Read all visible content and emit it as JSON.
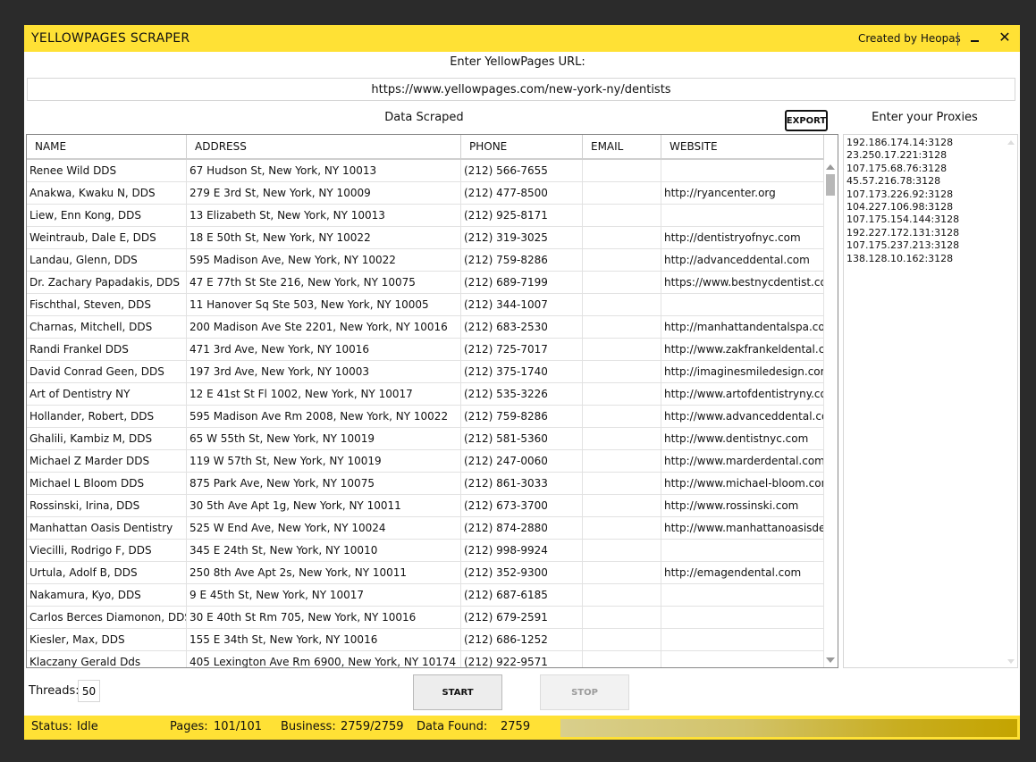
{
  "app": {
    "title": "YELLOWPAGES SCRAPER",
    "created_by": "Created by Heopas",
    "minimize_icon": "minimize-icon",
    "close_icon": "close-icon",
    "close_glyph": "✕"
  },
  "url_section": {
    "label": "Enter YellowPages URL:",
    "value": "https://www.yellowpages.com/new-york-ny/dentists"
  },
  "data_section": {
    "label": "Data Scraped",
    "export_label": "EXPORT"
  },
  "table": {
    "columns": [
      "NAME",
      "ADDRESS",
      "PHONE",
      "EMAIL",
      "WEBSITE"
    ],
    "rows": [
      [
        "Renee Wild DDS",
        "67 Hudson St, New York, NY 10013",
        "(212) 566-7655",
        "",
        ""
      ],
      [
        "Anakwa, Kwaku N, DDS",
        "279 E 3rd St, New York, NY 10009",
        "(212) 477-8500",
        "",
        "http://ryancenter.org"
      ],
      [
        "Liew, Enn Kong, DDS",
        "13 Elizabeth St, New York, NY 10013",
        "(212) 925-8171",
        "",
        ""
      ],
      [
        "Weintraub, Dale E, DDS",
        "18 E 50th St, New York, NY 10022",
        "(212) 319-3025",
        "",
        "http://dentistryofnyc.com"
      ],
      [
        "Landau, Glenn, DDS",
        "595 Madison Ave, New York, NY 10022",
        "(212) 759-8286",
        "",
        "http://advanceddental.com"
      ],
      [
        "Dr. Zachary Papadakis, DDS",
        "47 E 77th St Ste 216, New York, NY 10075",
        "(212) 689-7199",
        "",
        "https://www.bestnycdentist.com"
      ],
      [
        "Fischthal, Steven, DDS",
        "11 Hanover Sq Ste 503, New York, NY 10005",
        "(212) 344-1007",
        "",
        ""
      ],
      [
        "Charnas, Mitchell, DDS",
        "200 Madison Ave Ste 2201, New York, NY 10016",
        "(212) 683-2530",
        "",
        "http://manhattandentalspa.com"
      ],
      [
        "Randi Frankel DDS",
        "471 3rd Ave, New York, NY 10016",
        "(212) 725-7017",
        "",
        "http://www.zakfrankeldental.com"
      ],
      [
        "David Conrad Geen, DDS",
        "197 3rd Ave, New York, NY 10003",
        "(212) 375-1740",
        "",
        "http://imaginesmiledesign.com"
      ],
      [
        "Art of Dentistry NY",
        "12 E 41st St Fl 1002, New York, NY 10017",
        "(212) 535-3226",
        "",
        "http://www.artofdentistryny.com"
      ],
      [
        "Hollander, Robert, DDS",
        "595 Madison Ave Rm 2008, New York, NY 10022",
        "(212) 759-8286",
        "",
        "http://www.advanceddental.com"
      ],
      [
        "Ghalili, Kambiz M, DDS",
        "65 W 55th St, New York, NY 10019",
        "(212) 581-5360",
        "",
        "http://www.dentistnyc.com"
      ],
      [
        "Michael Z Marder DDS",
        "119 W 57th St, New York, NY 10019",
        "(212) 247-0060",
        "",
        "http://www.marderdental.com"
      ],
      [
        "Michael L Bloom DDS",
        "875 Park Ave, New York, NY 10075",
        "(212) 861-3033",
        "",
        "http://www.michael-bloom.com"
      ],
      [
        "Rossinski, Irina, DDS",
        "30 5th Ave Apt 1g, New York, NY 10011",
        "(212) 673-3700",
        "",
        "http://www.rossinski.com"
      ],
      [
        "Manhattan Oasis Dentistry",
        "525 W End Ave, New York, NY 10024",
        "(212) 874-2880",
        "",
        "http://www.manhattanoasisdentis"
      ],
      [
        "Viecilli, Rodrigo F, DDS",
        "345 E 24th St, New York, NY 10010",
        "(212) 998-9924",
        "",
        ""
      ],
      [
        "Urtula, Adolf B, DDS",
        "250 8th Ave Apt 2s, New York, NY 10011",
        "(212) 352-9300",
        "",
        "http://emagendental.com"
      ],
      [
        "Nakamura, Kyo, DDS",
        "9 E 45th St, New York, NY 10017",
        "(212) 687-6185",
        "",
        ""
      ],
      [
        "Carlos Berces Diamonon, DDS",
        "30 E 40th St Rm 705, New York, NY 10016",
        "(212) 679-2591",
        "",
        ""
      ],
      [
        "Kiesler, Max, DDS",
        "155 E 34th St, New York, NY 10016",
        "(212) 686-1252",
        "",
        ""
      ],
      [
        "Klaczany Gerald Dds",
        "405 Lexington Ave Rm 6900, New York, NY 10174",
        "(212) 922-9571",
        "",
        ""
      ]
    ]
  },
  "proxies": {
    "label": "Enter your Proxies",
    "list": [
      "192.186.174.14:3128",
      "23.250.17.221:3128",
      "107.175.68.76:3128",
      "45.57.216.78:3128",
      "107.173.226.92:3128",
      "104.227.106.98:3128",
      "107.175.154.144:3128",
      "192.227.172.131:3128",
      "107.175.237.213:3128",
      "138.128.10.162:3128"
    ]
  },
  "controls": {
    "threads_label": "Threads:",
    "threads_value": "50",
    "start_label": "START",
    "stop_label": "STOP"
  },
  "status": {
    "status_label": "Status:",
    "status_value": "Idle",
    "pages_label": "Pages:",
    "pages_value": "101/101",
    "business_label": "Business:",
    "business_value": "2759/2759",
    "data_found_label": "Data Found:",
    "data_found_value": "2759",
    "progress_fraction": 1.0
  },
  "colors": {
    "accent": "#ffe135",
    "background": "#2b2b2b",
    "progress_fill": "#c4a400"
  }
}
